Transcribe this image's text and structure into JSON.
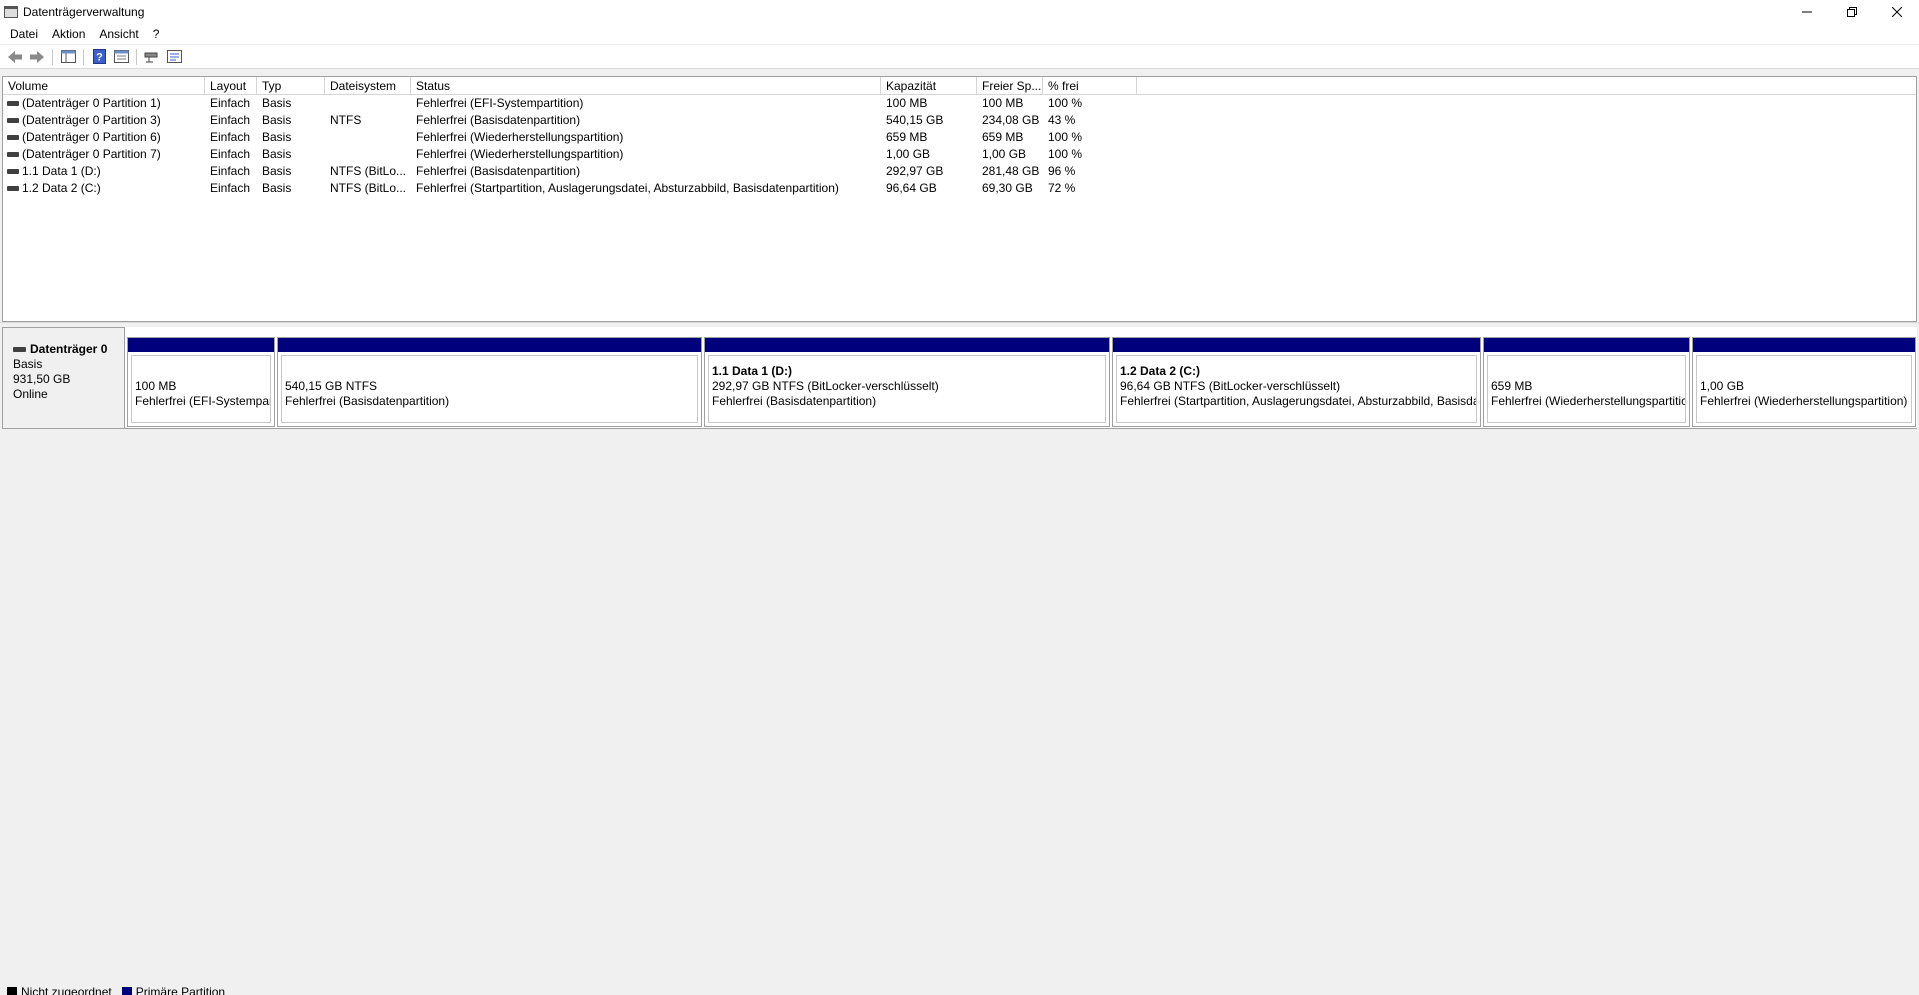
{
  "window": {
    "title": "Datenträgerverwaltung",
    "minimize_icon": "minimize-icon",
    "restore_icon": "restore-icon",
    "close_icon": "close-icon"
  },
  "menu": [
    "Datei",
    "Aktion",
    "Ansicht",
    "?"
  ],
  "toolbar": {
    "icons": [
      "back-arrow-icon",
      "forward-arrow-icon",
      "console-tree-icon",
      "help-icon",
      "properties-icon",
      "connect-drive-icon",
      "settings-icon"
    ]
  },
  "volume_list": {
    "columns": [
      "Volume",
      "Layout",
      "Typ",
      "Dateisystem",
      "Status",
      "Kapazität",
      "Freier Sp...",
      "% frei",
      ""
    ],
    "rows": [
      [
        "(Datenträger 0 Partition 1)",
        "Einfach",
        "Basis",
        "",
        "Fehlerfrei (EFI-Systempartition)",
        "100 MB",
        "100 MB",
        "100 %"
      ],
      [
        "(Datenträger 0 Partition 3)",
        "Einfach",
        "Basis",
        "NTFS",
        "Fehlerfrei (Basisdatenpartition)",
        "540,15 GB",
        "234,08 GB",
        "43 %"
      ],
      [
        "(Datenträger 0 Partition 6)",
        "Einfach",
        "Basis",
        "",
        "Fehlerfrei (Wiederherstellungspartition)",
        "659 MB",
        "659 MB",
        "100 %"
      ],
      [
        "(Datenträger 0 Partition 7)",
        "Einfach",
        "Basis",
        "",
        "Fehlerfrei (Wiederherstellungspartition)",
        "1,00 GB",
        "1,00 GB",
        "100 %"
      ],
      [
        "1.1 Data 1 (D:)",
        "Einfach",
        "Basis",
        "NTFS (BitLo...",
        "Fehlerfrei (Basisdatenpartition)",
        "292,97 GB",
        "281,48 GB",
        "96 %"
      ],
      [
        "1.2 Data 2 (C:)",
        "Einfach",
        "Basis",
        "NTFS (BitLo...",
        "Fehlerfrei (Startpartition, Auslagerungsdatei, Absturzabbild, Basisdatenpartition)",
        "96,64 GB",
        "69,30 GB",
        "72 %"
      ]
    ]
  },
  "disk": {
    "name": "Datenträger 0",
    "type": "Basis",
    "size": "931,50 GB",
    "state": "Online",
    "partitions": [
      {
        "name": "",
        "size_fs": "100 MB",
        "status": "Fehlerfrei (EFI-Systempart"
      },
      {
        "name": "",
        "size_fs": "540,15 GB NTFS",
        "status": "Fehlerfrei (Basisdatenpartition)"
      },
      {
        "name": "1.1 Data 1  (D:)",
        "size_fs": "292,97 GB NTFS (BitLocker-verschlüsselt)",
        "status": "Fehlerfrei (Basisdatenpartition)"
      },
      {
        "name": "1.2 Data 2  (C:)",
        "size_fs": "96,64 GB NTFS (BitLocker-verschlüsselt)",
        "status": "Fehlerfrei (Startpartition, Auslagerungsdatei, Absturzabbild, Basisdat"
      },
      {
        "name": "",
        "size_fs": "659 MB",
        "status": "Fehlerfrei (Wiederherstellungspartitic"
      },
      {
        "name": "",
        "size_fs": "1,00 GB",
        "status": "Fehlerfrei (Wiederherstellungspartition)"
      }
    ]
  },
  "legend": [
    {
      "label": "Nicht zugeordnet",
      "color": "#000000"
    },
    {
      "label": "Primäre Partition",
      "color": "#00007c"
    }
  ],
  "colors": {
    "partition_bar": "#00007c",
    "background": "#f0f0f0"
  }
}
